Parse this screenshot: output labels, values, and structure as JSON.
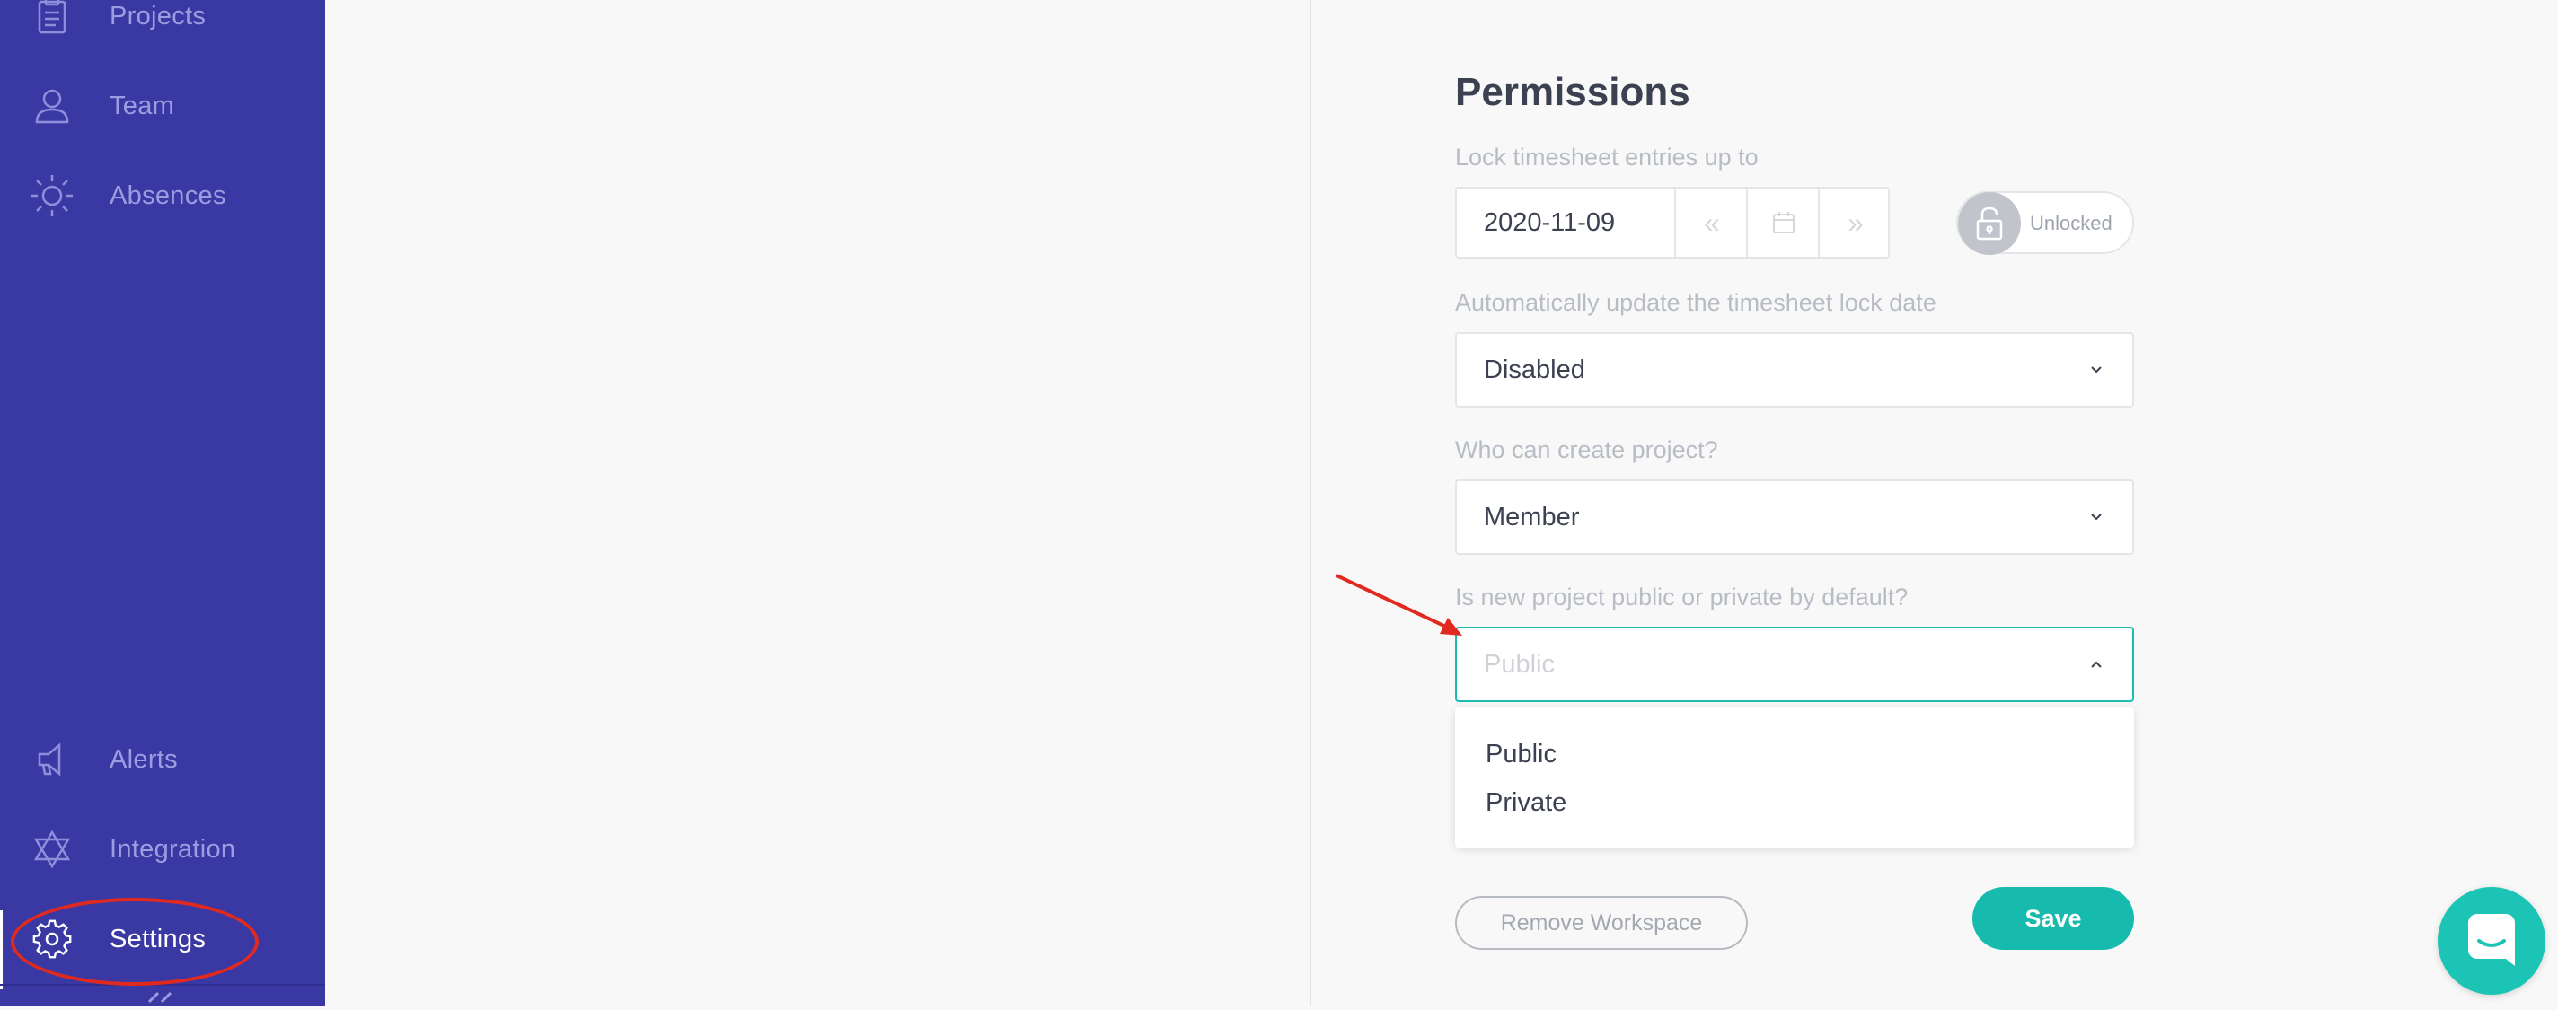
{
  "sidebar": {
    "items": [
      {
        "label": "Projects",
        "icon": "clipboard-icon"
      },
      {
        "label": "Team",
        "icon": "user-icon"
      },
      {
        "label": "Absences",
        "icon": "sun-icon"
      },
      {
        "label": "Alerts",
        "icon": "megaphone-icon"
      },
      {
        "label": "Integration",
        "icon": "star-of-david-icon"
      },
      {
        "label": "Settings",
        "icon": "gear-icon",
        "active": true
      }
    ],
    "collapse_icon": "double-chevron-left-icon"
  },
  "permissions": {
    "title": "Permissions",
    "lock_label": "Lock timesheet entries up to",
    "lock_date": "2020-11-09",
    "lock_status": "Unlocked",
    "auto_update_label": "Automatically update the timesheet lock date",
    "auto_update_value": "Disabled",
    "create_project_label": "Who can create project?",
    "create_project_value": "Member",
    "visibility_label": "Is new project public or private by default?",
    "visibility_placeholder": "Public",
    "visibility_options": [
      "Public",
      "Private"
    ],
    "remove_label": "Remove Workspace",
    "save_label": "Save"
  },
  "colors": {
    "sidebar": "#3a38a3",
    "accent": "#17bbad",
    "annotation": "#e02a1f"
  }
}
